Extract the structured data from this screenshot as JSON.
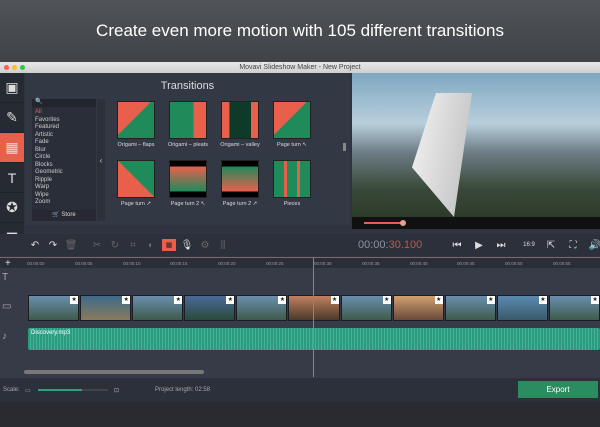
{
  "banner": {
    "headline": "Create even more motion with 105 different transitions"
  },
  "window": {
    "title": "Movavi Slideshow Maker - New Project"
  },
  "sidebar": {
    "icons": [
      "video-icon",
      "magic-wand-icon",
      "transitions-icon",
      "text-icon",
      "sticker-icon",
      "menu-icon"
    ]
  },
  "transitions": {
    "title": "Transitions",
    "search_placeholder": "",
    "categories": [
      "All",
      "Favorites",
      "Featured",
      "Artistic",
      "Fade",
      "Blur",
      "Circle",
      "Blocks",
      "Geometric",
      "Ripple",
      "Warp",
      "Wipe",
      "Zoom"
    ],
    "store_label": "Store",
    "items": [
      "Origami – flaps",
      "Origami – pleats",
      "Origami – valley",
      "Page turn ↖",
      "Page turn ↗",
      "Page turn 2 ↖",
      "Page turn 2 ↗",
      "Pieces"
    ]
  },
  "player": {
    "time_prefix": "00:00:",
    "time_value": "30.100",
    "aspect": "16:9",
    "progress": 0.2
  },
  "ruler": [
    "00:00:00",
    "00:00:05",
    "00:00:10",
    "00:00:15",
    "00:00:20",
    "00:00:25",
    "00:00:30",
    "00:00:35",
    "00:00:40",
    "00:00:45",
    "00:00:50",
    "00:00:55"
  ],
  "audio": {
    "clip_name": "Discovery.mp3"
  },
  "footer": {
    "scale_label": "Scale:",
    "project_length_label": "Project length:",
    "project_length": "02:58",
    "export_label": "Export",
    "scale_value": 0.63
  }
}
